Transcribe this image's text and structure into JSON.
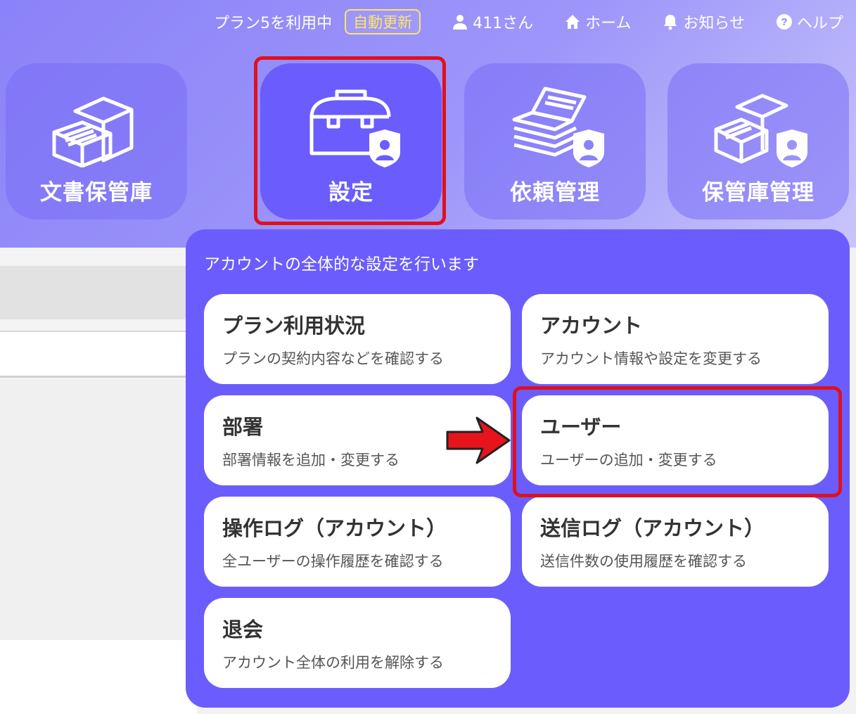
{
  "topbar": {
    "plan_status": "プラン5を利用中",
    "auto_renew_badge": "自動更新",
    "user": "411さん",
    "home": "ホーム",
    "notifications": "お知らせ",
    "help": "ヘルプ"
  },
  "main_nav": [
    {
      "label": "文書保管庫",
      "icon": "archive-boxes-icon"
    },
    {
      "label": "設定",
      "icon": "toolbox-admin-icon",
      "active": true
    },
    {
      "label": "依頼管理",
      "icon": "document-stack-admin-icon"
    },
    {
      "label": "保管庫管理",
      "icon": "archive-boxes-admin-icon"
    }
  ],
  "settings_menu": {
    "description": "アカウントの全体的な設定を行います",
    "items": [
      {
        "title": "プラン利用状況",
        "desc": "プランの契約内容などを確認する"
      },
      {
        "title": "アカウント",
        "desc": "アカウント情報や設定を変更する"
      },
      {
        "title": "部署",
        "desc": "部署情報を追加・変更する"
      },
      {
        "title": "ユーザー",
        "desc": "ユーザーの追加・変更する"
      },
      {
        "title": "操作ログ（アカウント）",
        "desc": "全ユーザーの操作履歴を確認する"
      },
      {
        "title": "送信ログ（アカウント）",
        "desc": "送信件数の使用履歴を確認する"
      },
      {
        "title": "退会",
        "desc": "アカウント全体の利用を解除する"
      }
    ]
  },
  "colors": {
    "panel": "#6b5dfd",
    "highlight": "#e0101e",
    "badge": "#ffe46b"
  }
}
